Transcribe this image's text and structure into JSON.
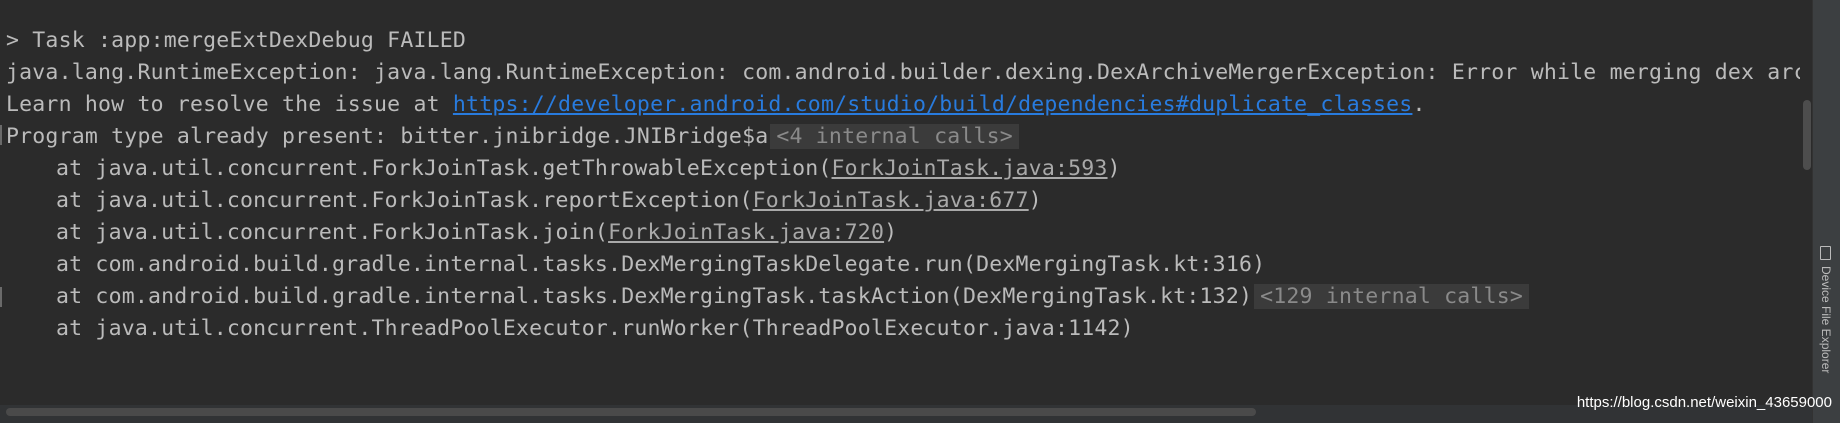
{
  "console": {
    "line1": "> Task :app:mergeExtDexDebug FAILED",
    "line2": "java.lang.RuntimeException: java.lang.RuntimeException: com.android.builder.dexing.DexArchiveMergerException: Error while merging dex archi",
    "line3_prefix": "Learn how to resolve the issue at ",
    "line3_link": "https://developer.android.com/studio/build/dependencies#duplicate_classes",
    "line3_suffix": ".",
    "line4_text": "Program type already present: bitter.jnibridge.JNIBridge$a",
    "line4_fold": "<4 internal calls>",
    "frames": [
      {
        "at": "at java.util.concurrent.ForkJoinTask.getThrowableException(",
        "src": "ForkJoinTask.java:593",
        "close": ")"
      },
      {
        "at": "at java.util.concurrent.ForkJoinTask.reportException(",
        "src": "ForkJoinTask.java:677",
        "close": ")"
      },
      {
        "at": "at java.util.concurrent.ForkJoinTask.join(",
        "src": "ForkJoinTask.java:720",
        "close": ")"
      },
      {
        "at": "at com.android.build.gradle.internal.tasks.DexMergingTaskDelegate.run(DexMergingTask.kt:316)"
      },
      {
        "at": "at com.android.build.gradle.internal.tasks.DexMergingTask.taskAction(DexMergingTask.kt:132)",
        "fold": "<129 internal calls>"
      },
      {
        "at": "at java.util.concurrent.ThreadPoolExecutor.runWorker(ThreadPoolExecutor.java:1142)"
      }
    ]
  },
  "toolwindow": {
    "device_file_explorer": "Device File Explorer",
    "icon": "device-icon"
  },
  "watermark": "https://blog.csdn.net/weixin_43659000",
  "colors": {
    "background": "#2b2b2b",
    "text": "#bbbbbb",
    "link": "#287bde",
    "fold_bg": "#3b3b3b"
  }
}
